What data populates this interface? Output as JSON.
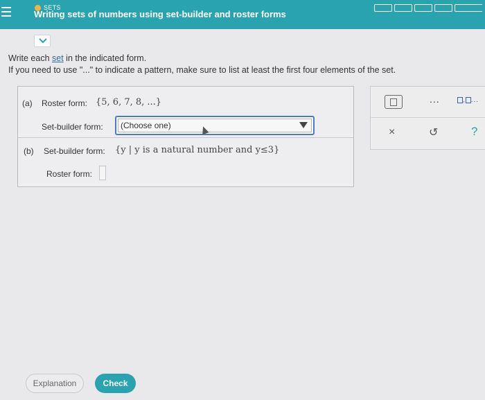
{
  "header": {
    "topic": "SETS",
    "title": "Writing sets of numbers using set-builder and roster forms",
    "progress_segments": 5
  },
  "instructions": {
    "line1_prefix": "Write each ",
    "line1_link": "set",
    "line1_suffix": " in the indicated form.",
    "line2": "If you need to use \"...\" to indicate a pattern, make sure to list at least the first four elements of the set."
  },
  "part_a": {
    "label": "(a)",
    "given_label": "Roster form:",
    "given_value": "{5, 6, 7, 8, ...}",
    "ask_label": "Set-builder form:",
    "select_value": "(Choose one)"
  },
  "part_b": {
    "label": "(b)",
    "given_label": "Set-builder form:",
    "given_value": "{y | y is a natural number and y≤3}",
    "ask_label": "Roster form:"
  },
  "tools": {
    "set_icon": "set-braces-icon",
    "ellipsis": "...",
    "pair_icon": "ordered-pair-icon",
    "clear": "×",
    "undo": "↺",
    "help": "?"
  },
  "footer": {
    "explanation_label": "Explanation",
    "check_label": "Check"
  }
}
